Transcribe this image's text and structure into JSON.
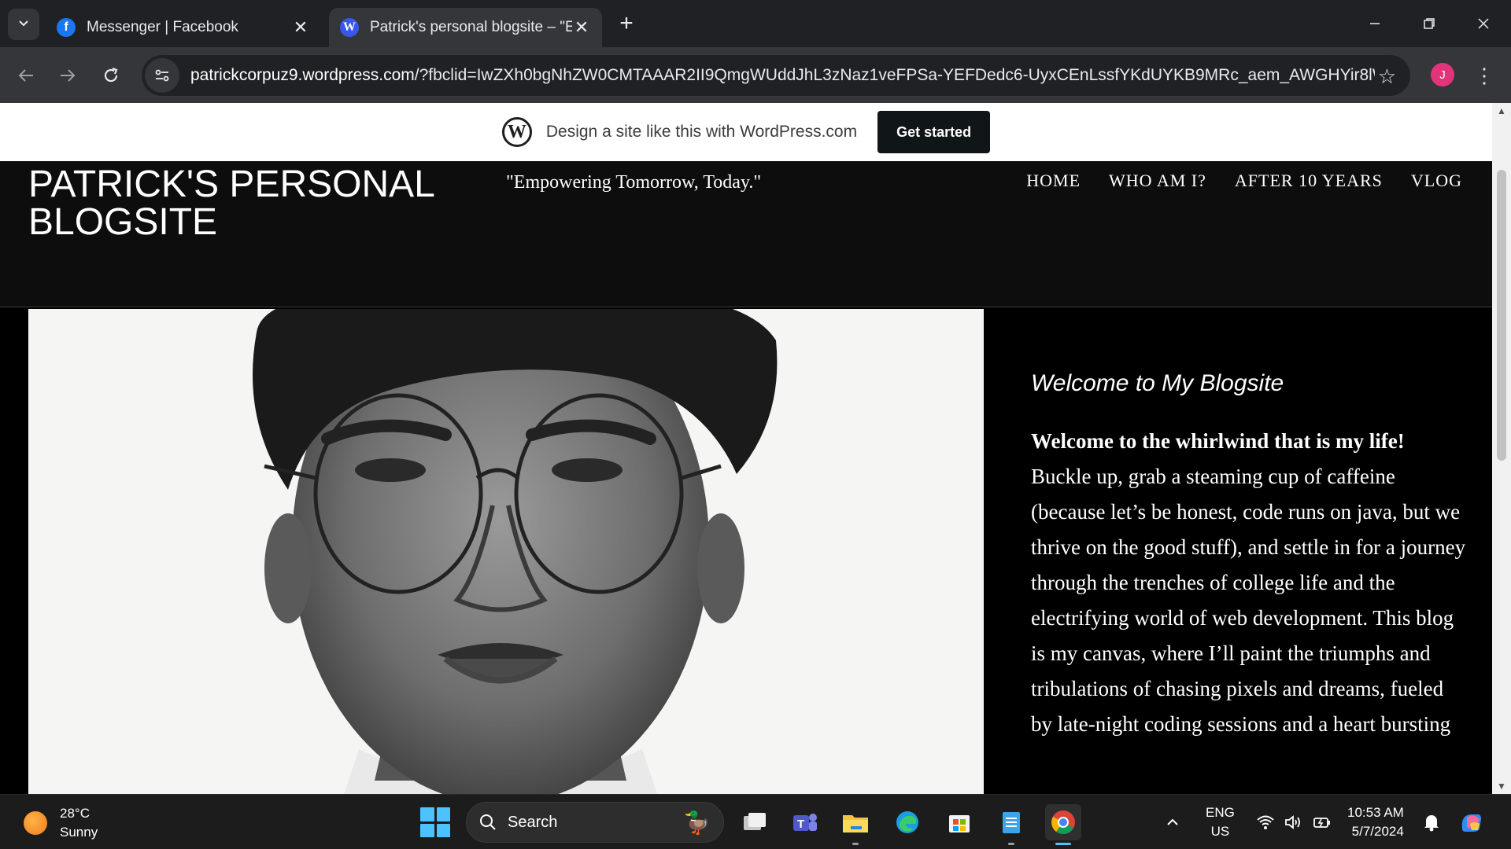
{
  "browser": {
    "tabs": [
      {
        "title": "Messenger | Facebook",
        "favicon": "facebook-icon",
        "active": false
      },
      {
        "title": "Patrick's personal blogsite – \"Em",
        "favicon": "wordpress-icon",
        "active": true
      }
    ],
    "url_domain": "patrickcorpuz9.wordpress.com",
    "url_path": "/?fbclid=IwZXh0bgNhZW0CMTAAAR2II9QmgWUddJhL3zNaz1veFPSa-YEFDedc6-UyxCEnLssfYKdUYKB9MRc_aem_AWGHYir8lWG3...",
    "profile_initial": "J",
    "profile_color": "#e2347a"
  },
  "wp_banner": {
    "text": "Design a site like this with WordPress.com",
    "button": "Get started"
  },
  "site": {
    "title": "PATRICK'S PERSONAL BLOGSITE",
    "tagline": "\"Empowering Tomorrow, Today.\"",
    "nav": [
      "HOME",
      "WHO AM I?",
      "AFTER 10 YEARS",
      "VLOG"
    ]
  },
  "post": {
    "title": "Welcome to My Blogsite",
    "lead": "Welcome to the whirlwind that is my life!",
    "body": " Buckle up, grab a steaming cup of caffeine (because let’s be honest, code runs on java, but we thrive on the good stuff), and settle in for a journey through the trenches of college life and the electrifying world of web development. This blog is my canvas, where I’ll paint the triumphs and tribulations of chasing pixels and dreams, fueled by late-night coding sessions and a heart bursting"
  },
  "taskbar": {
    "weather_temp": "28°C",
    "weather_desc": "Sunny",
    "search_label": "Search",
    "lang_top": "ENG",
    "lang_bottom": "US",
    "time": "10:53 AM",
    "date": "5/7/2024"
  },
  "colors": {
    "accent": "#4cc2ff",
    "page_background": "#0d0d0d",
    "wp_button": "#101517"
  }
}
